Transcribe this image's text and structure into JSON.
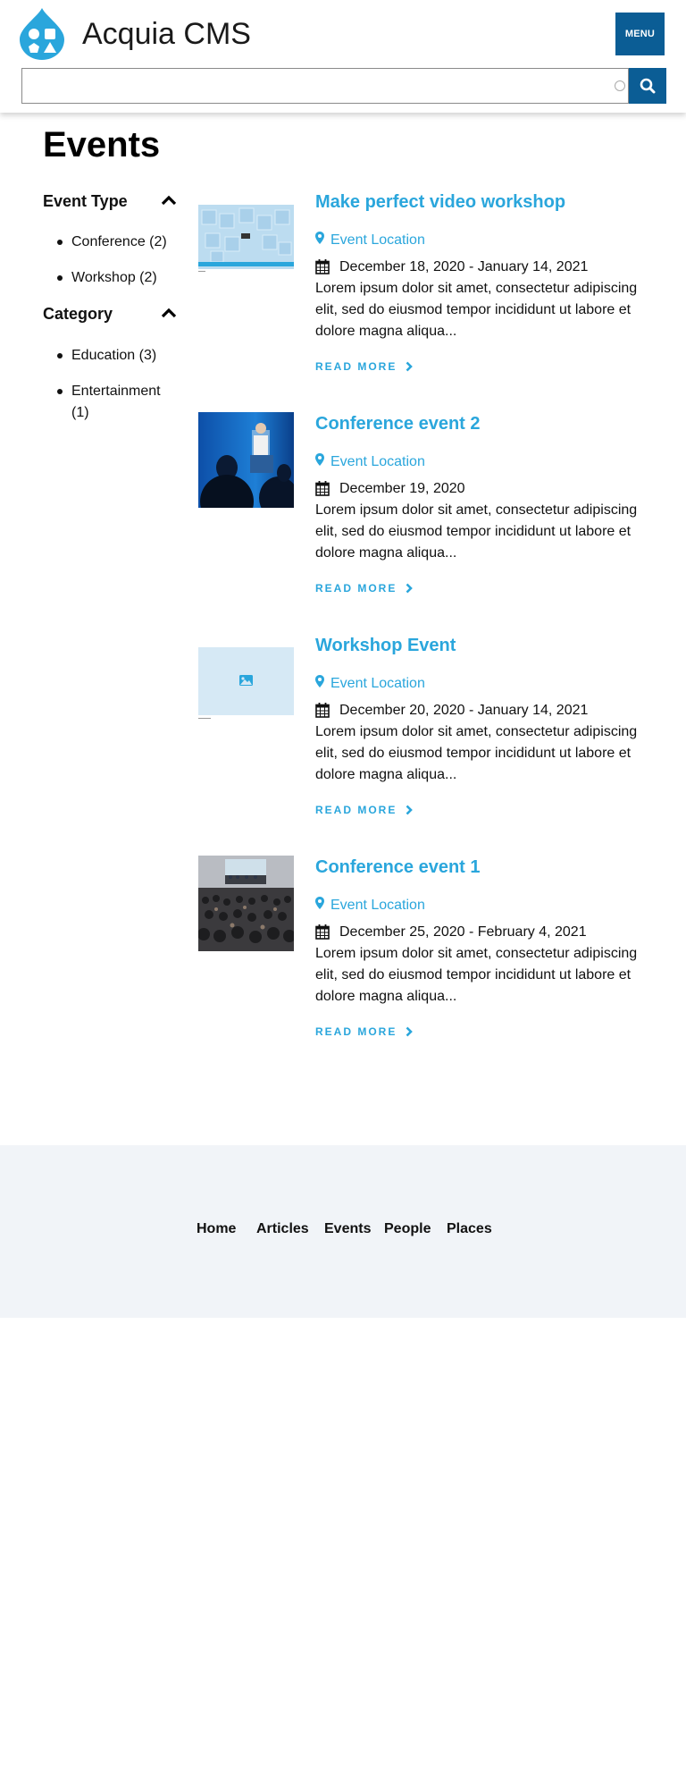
{
  "header": {
    "site_name": "Acquia CMS",
    "menu_label": "MENU",
    "search_placeholder": "",
    "brand_color": "#2aa6dc",
    "button_color": "#0b5d95"
  },
  "page": {
    "title": "Events"
  },
  "facets": [
    {
      "title": "Event Type",
      "items": [
        "Conference (2)",
        "Workshop (2)"
      ]
    },
    {
      "title": "Category",
      "items": [
        "Education (3)",
        "Entertainment (1)"
      ]
    }
  ],
  "events": [
    {
      "title": "Make perfect video workshop",
      "location": "Event Location",
      "date": "December 18, 2020 - January 14, 2021",
      "body": "Lorem ipsum dolor sit amet, consectetur adipiscing elit, sed do eiusmod tempor incididunt ut labore et dolore magna aliqua...",
      "read_more": "READ MORE",
      "image": "video-wall-thumbnail"
    },
    {
      "title": "Conference event 2",
      "location": "Event Location",
      "date": "December 19, 2020",
      "body": "Lorem ipsum dolor sit amet, consectetur adipiscing elit, sed do eiusmod tempor incididunt ut labore et dolore magna aliqua...",
      "read_more": "READ MORE",
      "image": "conference-speaker-photo"
    },
    {
      "title": "Workshop Event",
      "location": "Event Location",
      "date": "December 20, 2020 - January 14, 2021",
      "body": "Lorem ipsum dolor sit amet, consectetur adipiscing elit, sed do eiusmod tempor incididunt ut labore et dolore magna aliqua...",
      "read_more": "READ MORE",
      "image": "image-placeholder"
    },
    {
      "title": "Conference event 1",
      "location": "Event Location",
      "date": "December 25, 2020 - February 4, 2021",
      "body": "Lorem ipsum dolor sit amet, consectetur adipiscing elit, sed do eiusmod tempor incididunt ut labore et dolore magna aliqua...",
      "read_more": "READ MORE",
      "image": "conference-audience-photo"
    }
  ],
  "footer": {
    "links": [
      "Home",
      "Articles",
      "Events",
      "People",
      "Places"
    ]
  }
}
